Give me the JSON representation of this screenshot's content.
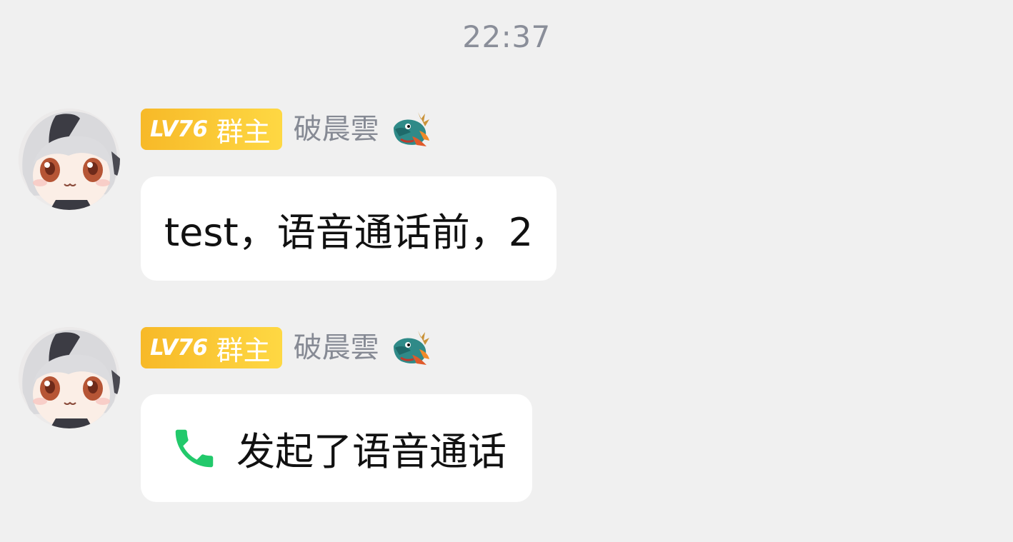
{
  "timestamp": "22:37",
  "colors": {
    "background": "#f0f0f0",
    "badge_start": "#f7b928",
    "badge_end": "#fed843",
    "nickname": "#868a94",
    "call_icon": "#22c96b"
  },
  "messages": [
    {
      "avatar_icon": "anime-girl-avatar",
      "level": "LV76",
      "role": "群主",
      "nickname": "破晨雲",
      "nickname_emoji_icon": "dragon-emoji-icon",
      "type": "text",
      "text": "test，语音通话前，2"
    },
    {
      "avatar_icon": "anime-girl-avatar",
      "level": "LV76",
      "role": "群主",
      "nickname": "破晨雲",
      "nickname_emoji_icon": "dragon-emoji-icon",
      "type": "voice-call",
      "call_icon": "phone-icon",
      "text": "发起了语音通话"
    }
  ]
}
